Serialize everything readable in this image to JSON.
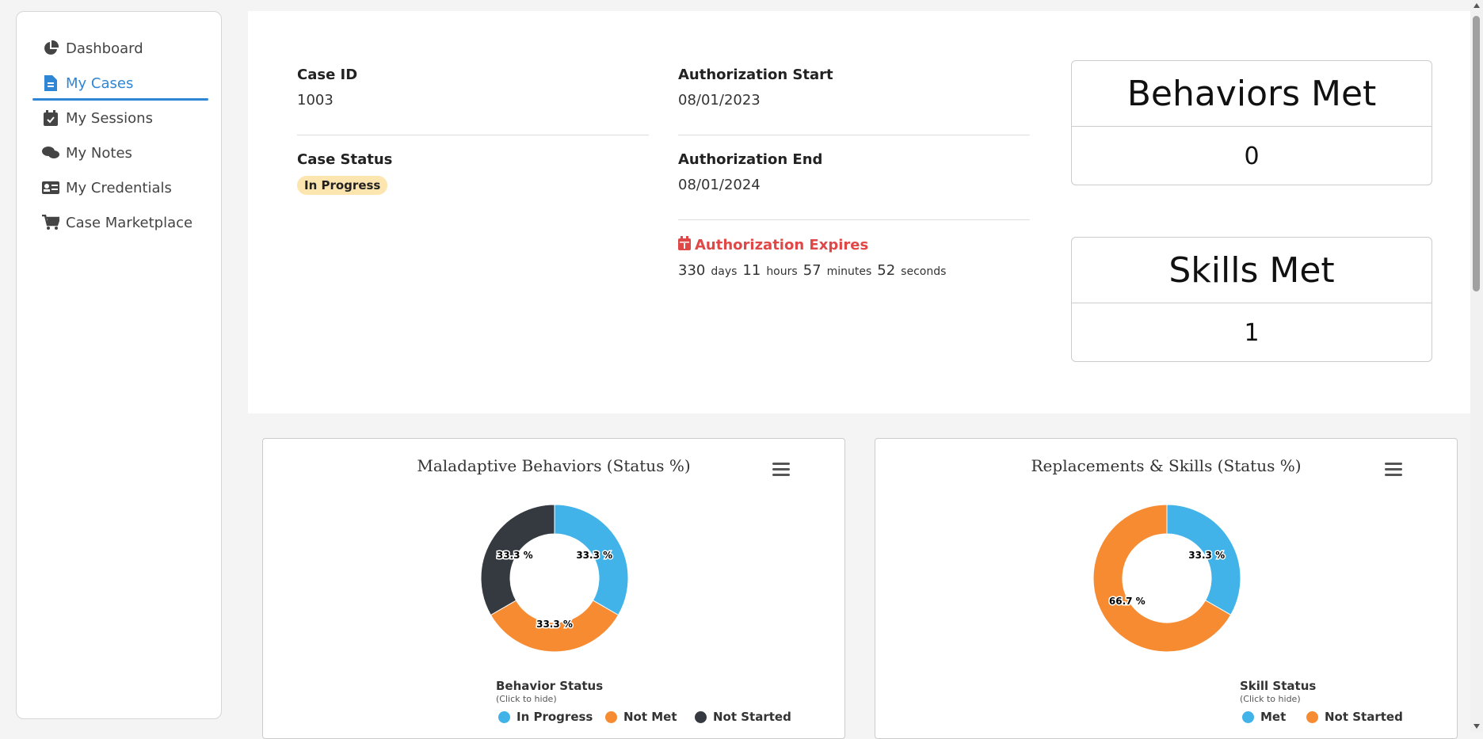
{
  "sidebar": {
    "items": [
      {
        "label": "Dashboard",
        "icon": "pie-chart-icon"
      },
      {
        "label": "My Cases",
        "icon": "file-icon"
      },
      {
        "label": "My Sessions",
        "icon": "calendar-check-icon"
      },
      {
        "label": "My Notes",
        "icon": "comments-icon"
      },
      {
        "label": "My Credentials",
        "icon": "id-card-icon"
      },
      {
        "label": "Case Marketplace",
        "icon": "cart-icon"
      }
    ],
    "active_index": 1,
    "accent_color": "#2f86d4"
  },
  "case": {
    "id_label": "Case ID",
    "id_value": "1003",
    "status_label": "Case Status",
    "status_value": "In Progress",
    "auth_start_label": "Authorization Start",
    "auth_start_value": "08/01/2023",
    "auth_end_label": "Authorization End",
    "auth_end_value": "08/01/2024",
    "expires_label": "Authorization Expires",
    "countdown": {
      "days": "330",
      "days_unit": "days",
      "hours": "11",
      "hours_unit": "hours",
      "minutes": "57",
      "minutes_unit": "minutes",
      "seconds": "52",
      "seconds_unit": "seconds"
    }
  },
  "stats": {
    "behaviors_title": "Behaviors Met",
    "behaviors_value": "0",
    "skills_title": "Skills Met",
    "skills_value": "1"
  },
  "chart_data": [
    {
      "type": "pie",
      "title": "Maladaptive Behaviors (Status %)",
      "legend_title": "Behavior Status",
      "legend_subtitle": "(Click to hide)",
      "categories": [
        "In Progress",
        "Not Met",
        "Not Started"
      ],
      "values": [
        33.3,
        33.3,
        33.3
      ],
      "labels": [
        "33.3 %",
        "33.3 %",
        "33.3 %"
      ],
      "colors": [
        "#41b3e8",
        "#f78b32",
        "#343a40"
      ]
    },
    {
      "type": "pie",
      "title": "Replacements & Skills (Status %)",
      "legend_title": "Skill Status",
      "legend_subtitle": "(Click to hide)",
      "categories": [
        "Met",
        "Not Started"
      ],
      "values": [
        33.3,
        66.7
      ],
      "labels": [
        "33.3 %",
        "66.7 %"
      ],
      "colors": [
        "#41b3e8",
        "#f78b32"
      ]
    }
  ]
}
